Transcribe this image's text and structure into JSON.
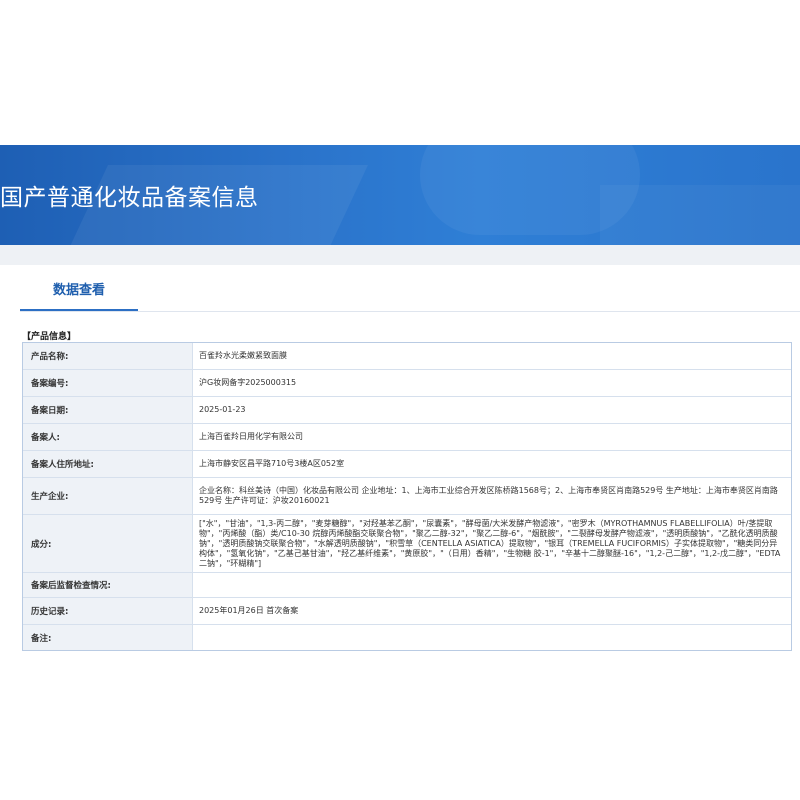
{
  "page": {
    "title": "国产普通化妆品备案信息",
    "tab_label": "数据查看",
    "section_title": "【产品信息】"
  },
  "record": {
    "rows": [
      {
        "label": "产品名称:",
        "value": "百雀羚水光柔嫩紧致面膜"
      },
      {
        "label": "备案编号:",
        "value": "沪G妆网备字2025000315"
      },
      {
        "label": "备案日期:",
        "value": "2025-01-23"
      },
      {
        "label": "备案人:",
        "value": "上海百雀羚日用化学有限公司"
      },
      {
        "label": "备案人住所地址:",
        "value": "上海市静安区昌平路710号3楼A区052室"
      },
      {
        "label": "生产企业:",
        "value": "企业名称：科丝美诗（中国）化妆品有限公司 企业地址：1、上海市工业综合开发区陈桥路1568号；2、上海市奉贤区肖南路529号 生产地址：上海市奉贤区肖南路529号 生产许可证：沪妆20160021"
      },
      {
        "label": "成分:",
        "value": "[\"水\"，\"甘油\"，\"1,3-丙二醇\"，\"麦芽糖醇\"，\"对羟基苯乙酮\"，\"尿囊素\"，\"酵母菌/大米发酵产物滤液\"，\"密罗木（MYROTHAMNUS FLABELLIFOLIA）叶/茎提取物\"，\"丙烯酸（酯）类/C10-30 烷醇丙烯酸酯交联聚合物\"，\"聚乙二醇-32\"，\"聚乙二醇-6\"，\"烟酰胺\"，\"二裂酵母发酵产物滤液\"，\"透明质酸钠\"，\"乙酰化透明质酸钠\"，\"透明质酸钠交联聚合物\"，\"水解透明质酸钠\"，\"积雪草（CENTELLA ASIATICA）提取物\"，\"银耳（TREMELLA FUCIFORMIS）子实体提取物\"，\"糖类同分异构体\"，\"氢氧化钠\"，\"乙基己基甘油\"，\"羟乙基纤维素\"，\"黄原胶\"，\"（日用）香精\"，\"生物糖 胶-1\"，\"辛基十二醇聚醚-16\"，\"1,2-己二醇\"，\"1,2-戊二醇\"，\"EDTA 二钠\"，\"环糊精\"]"
      },
      {
        "label": "备案后监督检查情况:",
        "value": ""
      },
      {
        "label": "历史记录:",
        "value": "2025年01月26日 首次备案"
      },
      {
        "label": "备注:",
        "value": ""
      }
    ]
  },
  "colors": {
    "banner": "#2a72c9",
    "tab_active": "#1f5fae",
    "label_bg": "#eef2f7",
    "table_border": "#b9cbe3"
  }
}
